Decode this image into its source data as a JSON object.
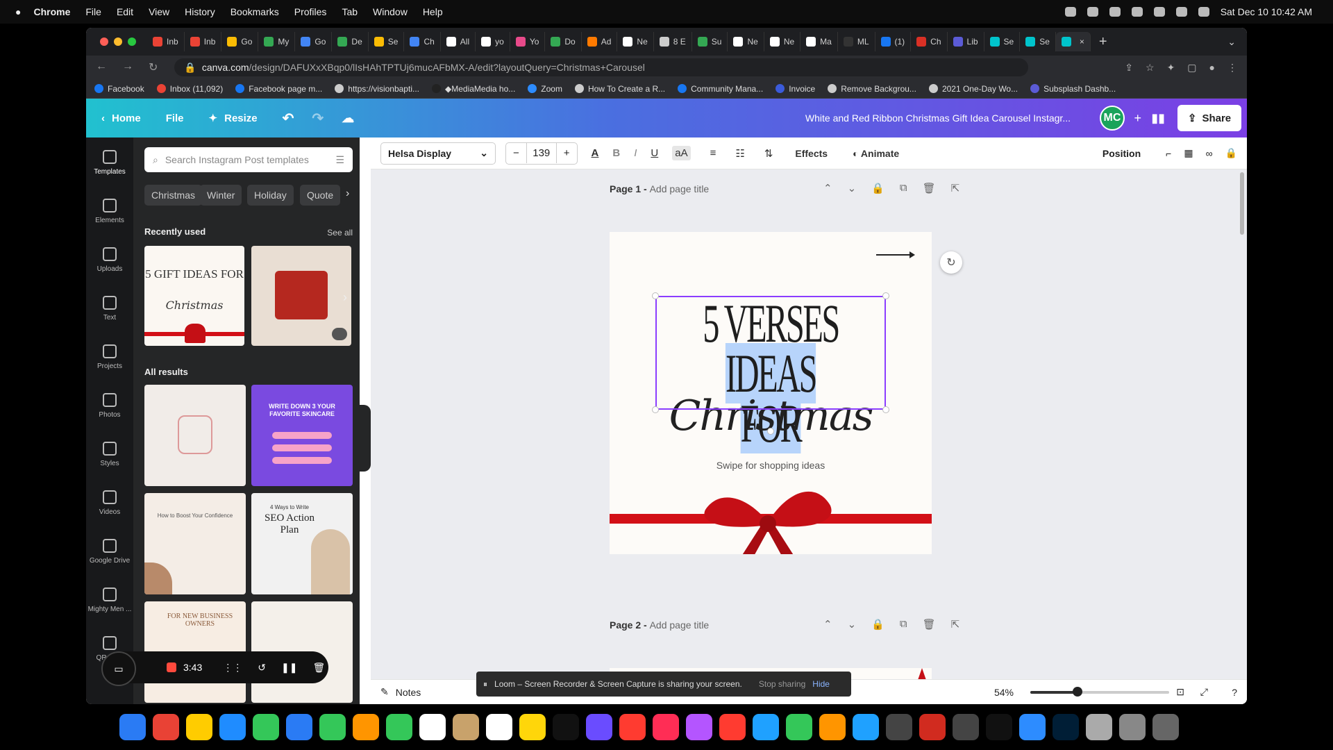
{
  "menubar": {
    "app": "Chrome",
    "items": [
      "File",
      "Edit",
      "View",
      "History",
      "Bookmarks",
      "Profiles",
      "Tab",
      "Window",
      "Help"
    ],
    "clock": "Sat Dec 10  10:42 AM"
  },
  "tabs": [
    {
      "label": "Inb",
      "color": "#ea4335"
    },
    {
      "label": "Inb",
      "color": "#ea4335"
    },
    {
      "label": "Go",
      "color": "#fbbc04"
    },
    {
      "label": "My",
      "color": "#34a853"
    },
    {
      "label": "Go",
      "color": "#4285f4"
    },
    {
      "label": "De",
      "color": "#34a853"
    },
    {
      "label": "Se",
      "color": "#fbbc04"
    },
    {
      "label": "Ch",
      "color": "#4285f4"
    },
    {
      "label": "All",
      "color": "#ffffff"
    },
    {
      "label": "yo",
      "color": "#ffffff"
    },
    {
      "label": "Yo",
      "color": "#e84a8a"
    },
    {
      "label": "Do",
      "color": "#34a853"
    },
    {
      "label": "Ad",
      "color": "#ff7a00"
    },
    {
      "label": "Ne",
      "color": "#ffffff"
    },
    {
      "label": "8 E",
      "color": "#cccccc"
    },
    {
      "label": "Su",
      "color": "#34a853"
    },
    {
      "label": "Ne",
      "color": "#ffffff"
    },
    {
      "label": "Ne",
      "color": "#ffffff"
    },
    {
      "label": "Ma",
      "color": "#ffffff"
    },
    {
      "label": "ML",
      "color": "#333333"
    },
    {
      "label": "(1)",
      "color": "#1877f2"
    },
    {
      "label": "Ch",
      "color": "#d93025"
    },
    {
      "label": "Lib",
      "color": "#5b5bd6"
    },
    {
      "label": "Se",
      "color": "#00c4cc"
    },
    {
      "label": "Se",
      "color": "#00c4cc"
    },
    {
      "label": "",
      "color": "#00c4cc",
      "active": true
    }
  ],
  "address": {
    "host": "canva.com",
    "path": "/design/DAFUXxXBqp0/lIsHAhTPTUj6mucAFbMX-A/edit?layoutQuery=Christmas+Carousel"
  },
  "bookmarks": [
    {
      "label": "Facebook",
      "color": "#1877f2"
    },
    {
      "label": "Inbox (11,092)",
      "color": "#ea4335"
    },
    {
      "label": "Facebook page m...",
      "color": "#1877f2"
    },
    {
      "label": "https://visionbapti...",
      "color": "#cccccc"
    },
    {
      "label": "◆MediaMedia ho...",
      "color": "#222222"
    },
    {
      "label": "Zoom",
      "color": "#2d8cff"
    },
    {
      "label": "How To Create a R...",
      "color": "#cccccc"
    },
    {
      "label": "Community Mana...",
      "color": "#1877f2"
    },
    {
      "label": "Invoice",
      "color": "#3b5bdb"
    },
    {
      "label": "Remove Backgrou...",
      "color": "#cccccc"
    },
    {
      "label": "2021 One-Day Wo...",
      "color": "#cccccc"
    },
    {
      "label": "Subsplash Dashb...",
      "color": "#5b5bd6"
    }
  ],
  "canva": {
    "home": "Home",
    "file": "File",
    "resize": "Resize",
    "doc_title": "White and Red Ribbon Christmas Gift Idea Carousel Instagr...",
    "avatar": "MC",
    "share": "Share"
  },
  "leftnav": [
    "Templates",
    "Elements",
    "Uploads",
    "Text",
    "Projects",
    "Photos",
    "Styles",
    "Videos",
    "Google Drive",
    "Mighty Men ...",
    "QR Co..."
  ],
  "panel": {
    "search_placeholder": "Search Instagram Post templates",
    "chips": [
      "Christmas",
      "Winter",
      "Holiday",
      "Quote"
    ],
    "recent": "Recently used",
    "see_all": "See all",
    "all_results": "All results",
    "thumb_texts": {
      "r1": "5 GIFT IDEAS FOR",
      "r1b": "Christmas",
      "a2": "WRITE DOWN 3 YOUR FAVORITE SKINCARE",
      "a4": "SEO Action Plan",
      "a4a": "4 Ways to Write",
      "a3": "How to Boost Your Confidence",
      "a5": "FOR NEW BUSINESS OWNERS"
    }
  },
  "toolbar": {
    "font": "Helsa Display",
    "size": "139",
    "effects": "Effects",
    "animate": "Animate",
    "position": "Position"
  },
  "editor": {
    "page1_label": "Page 1 - ",
    "page2_label": "Page 2 - ",
    "add_title": "Add page title",
    "line1": "5 VERSES",
    "line2": "IDEAS FOR",
    "script": "Christmas",
    "swipe": "Swipe for shopping ideas"
  },
  "bottom": {
    "notes": "Notes",
    "loom_text": "Loom – Screen Recorder & Screen Capture is sharing your screen.",
    "stop": "Stop sharing",
    "hide": "Hide",
    "zoom": "54%",
    "zoom_fraction": 0.34
  },
  "recorder": {
    "time": "3:43"
  },
  "colors": {
    "accent": "#8b3dff",
    "ribbon": "#d31017",
    "highlight": "#b7d4fb"
  },
  "dock": [
    "#2a7bf4",
    "#e94235",
    "#ffcc00",
    "#1f8cff",
    "#34c759",
    "#2a7bf4",
    "#34c759",
    "#ff9500",
    "#34c759",
    "#ffffff",
    "#c8a26b",
    "#ffffff",
    "#ffd60a",
    "#111111",
    "#6a4cff",
    "#ff3b30",
    "#ff2d55",
    "#b455ff",
    "#ff3b30",
    "#1fa1ff",
    "#34c759",
    "#ff9500",
    "#1fa1ff",
    "#444444",
    "#d12b1f",
    "#444444",
    "#111111",
    "#2d8cff",
    "#001e36",
    "#aaaaaa",
    "#888888",
    "#666666"
  ]
}
